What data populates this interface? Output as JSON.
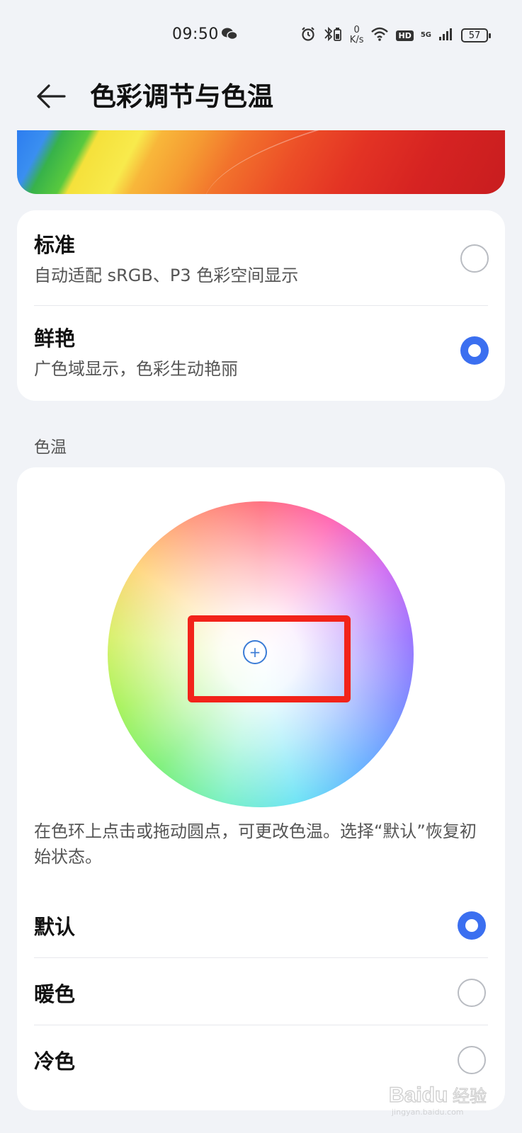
{
  "status_bar": {
    "time": "09:50",
    "speed_value": "0",
    "speed_unit": "K/s",
    "hd_label": "HD",
    "network_label": "5G",
    "battery_level": "57"
  },
  "header": {
    "back_icon": "arrow-left-icon",
    "title": "色彩调节与色温"
  },
  "color_mode": {
    "options": [
      {
        "title": "标准",
        "description": "自动适配 sRGB、P3 色彩空间显示",
        "selected": false
      },
      {
        "title": "鲜艳",
        "description": "广色域显示，色彩生动艳丽",
        "selected": true
      }
    ]
  },
  "color_temperature": {
    "section_label": "色温",
    "hint": "在色环上点击或拖动圆点，可更改色温。选择“默认”恢复初始状态。",
    "handle_symbol": "+",
    "options": [
      {
        "title": "默认",
        "selected": true
      },
      {
        "title": "暖色",
        "selected": false
      },
      {
        "title": "冷色",
        "selected": false
      }
    ]
  },
  "colors": {
    "accent": "#3b6ff0",
    "highlight": "#f2231a",
    "background": "#f1f3f7"
  },
  "watermark": {
    "text": "Baidu经验",
    "subtext": "jingyan.baidu.com"
  }
}
